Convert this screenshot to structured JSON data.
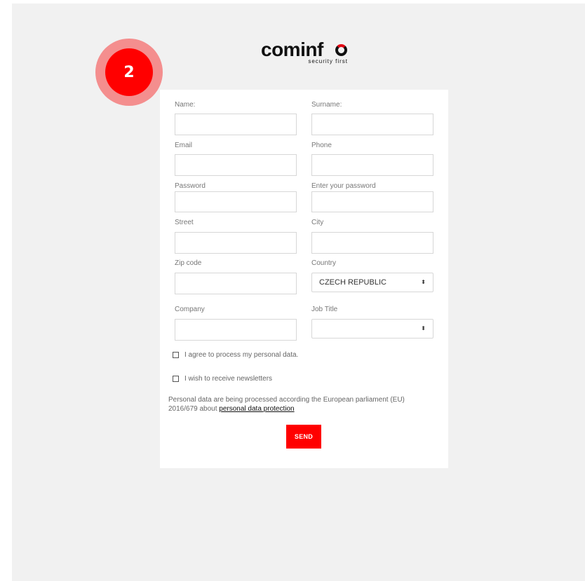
{
  "brand": {
    "name": "cominfo",
    "name_prefix": "cominf",
    "tagline": "security first",
    "accent_color": "#e30613"
  },
  "step_badge": {
    "number": "2",
    "color": "#ff0000"
  },
  "form": {
    "labels": {
      "name": "Name:",
      "surname": "Surname:",
      "email": "Email",
      "phone": "Phone",
      "password": "Password",
      "password_confirm": "Enter your password",
      "street": "Street",
      "city": "City",
      "zip": "Zip code",
      "country": "Country",
      "company": "Company",
      "job_title": "Job Title"
    },
    "values": {
      "name": "",
      "surname": "",
      "email": "",
      "phone": "",
      "password": "",
      "password_confirm": "",
      "street": "",
      "city": "",
      "zip": "",
      "company": ""
    },
    "country_selected": "CZECH REPUBLIC",
    "job_title_selected": "",
    "select_arrow": "⬍",
    "checkboxes": {
      "consent": "I agree to process my personal data.",
      "newsletter": "I wish to receive newsletters"
    },
    "notice_text": "Personal data are being processed according the European parliament (EU) 2016/679 about",
    "notice_link": "personal data protection",
    "submit_label": "SEND"
  }
}
